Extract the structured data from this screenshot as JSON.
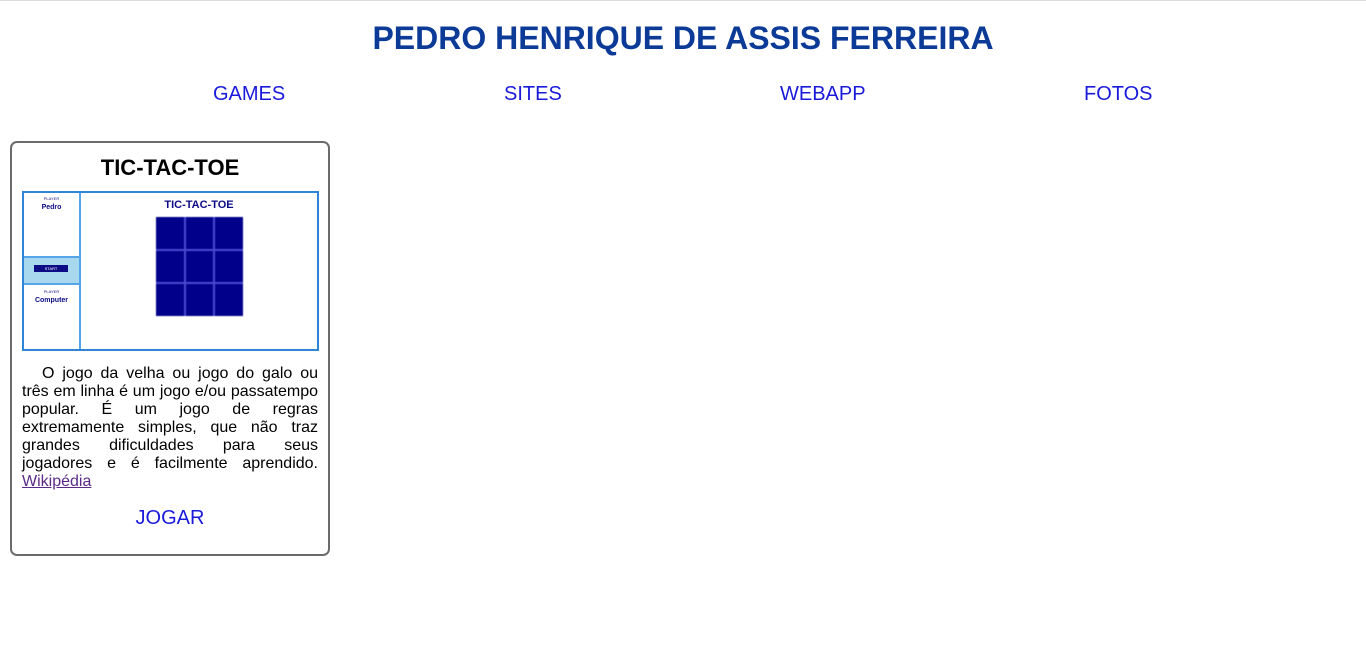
{
  "header": {
    "title": "PEDRO HENRIQUE DE ASSIS FERREIRA"
  },
  "nav": {
    "items": [
      "GAMES",
      "SITES",
      "WEBAPP",
      "FOTOS"
    ]
  },
  "colors": {
    "title": "#0b3a97",
    "link": "#1a1adb",
    "visited_link": "#5b2a86",
    "card_border": "#6b6b6b",
    "preview_border": "#2f86d6",
    "board": "#00008b"
  },
  "card": {
    "title": "TIC-TAC-TOE",
    "preview": {
      "player_label_top": "PLAYER",
      "player_name_top": "Pedro",
      "start_label": "START",
      "player_label_bottom": "PLAYER",
      "player_name_bottom": "Computer",
      "game_title": "TIC-TAC-TOE"
    },
    "description": "O jogo da velha ou jogo do galo ou três em linha é um jogo e/ou passatempo popular. É um jogo de regras extremamente simples, que não traz grandes dificuldades para seus jogadores e é facilmente aprendido.",
    "wiki_label": "Wikipédia",
    "play_label": "JOGAR"
  }
}
